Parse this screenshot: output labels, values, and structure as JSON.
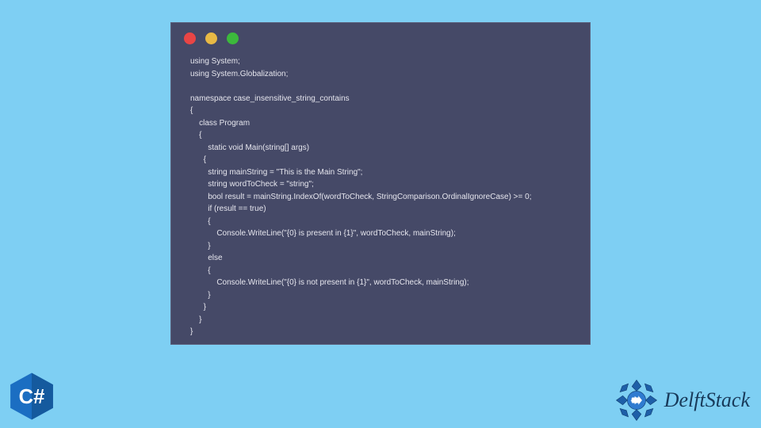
{
  "window": {
    "dots": {
      "red": "#e84545",
      "yellow": "#e8b945",
      "green": "#3cb93c"
    }
  },
  "code": {
    "lines": [
      "using System;",
      "using System.Globalization;",
      "",
      "namespace case_insensitive_string_contains",
      "{",
      "    class Program",
      "    {",
      "        static void Main(string[] args)",
      "      {",
      "        string mainString = \"This is the Main String\";",
      "        string wordToCheck = \"string\";",
      "        bool result = mainString.IndexOf(wordToCheck, StringComparison.OrdinalIgnoreCase) >= 0;",
      "        if (result == true)",
      "        {",
      "            Console.WriteLine(\"{0} is present in {1}\", wordToCheck, mainString);",
      "        }",
      "        else",
      "        {",
      "            Console.WriteLine(\"{0} is not present in {1}\", wordToCheck, mainString);",
      "        }",
      "      }",
      "    }",
      "}"
    ]
  },
  "badges": {
    "csharp_label": "C#",
    "delft_label": "DelftStack"
  },
  "colors": {
    "page_bg": "#7ecff3",
    "window_bg": "#454967",
    "code_text": "#e6e6ee",
    "csharp_blue": "#1b6ec2",
    "delft_accent": "#1e5fa8",
    "delft_text": "#183a5a"
  }
}
